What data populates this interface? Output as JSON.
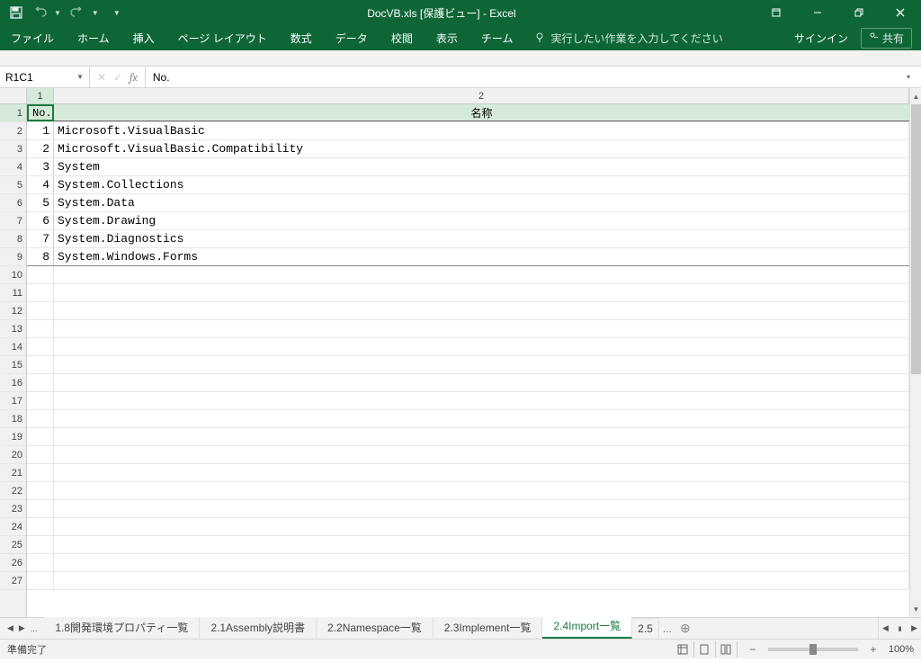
{
  "title": "DocVB.xls  [保護ビュー] - Excel",
  "qat": {
    "save": "save",
    "undo": "undo",
    "redo": "redo"
  },
  "win": {
    "ribbon_opts": "ribbon-options",
    "minimize": "minimize",
    "maximize": "restore",
    "close": "close"
  },
  "tabs": {
    "file": "ファイル",
    "home": "ホーム",
    "insert": "挿入",
    "page_layout": "ページ レイアウト",
    "formulas": "数式",
    "data": "データ",
    "review": "校閲",
    "view": "表示",
    "team": "チーム"
  },
  "tell_me": "実行したい作業を入力してください",
  "sign_in": "サインイン",
  "share": "共有",
  "name_box": "R1C1",
  "formula": "No.",
  "col_headers": {
    "c1": "1",
    "c2": "2"
  },
  "row_count": 27,
  "headers": {
    "no": "No.",
    "name": "名称"
  },
  "rows": [
    {
      "no": "1",
      "name": "Microsoft.VisualBasic"
    },
    {
      "no": "2",
      "name": "Microsoft.VisualBasic.Compatibility"
    },
    {
      "no": "3",
      "name": "System"
    },
    {
      "no": "4",
      "name": "System.Collections"
    },
    {
      "no": "5",
      "name": "System.Data"
    },
    {
      "no": "6",
      "name": "System.Drawing"
    },
    {
      "no": "7",
      "name": "System.Diagnostics"
    },
    {
      "no": "8",
      "name": "System.Windows.Forms"
    }
  ],
  "sheet_nav_ellipsis": "...",
  "sheets": [
    {
      "label": "1.8開発環境プロパティ一覧",
      "active": false
    },
    {
      "label": "2.1Assembly説明書",
      "active": false
    },
    {
      "label": "2.2Namespace一覧",
      "active": false
    },
    {
      "label": "2.3Implement一覧",
      "active": false
    },
    {
      "label": "2.4Import一覧",
      "active": true
    },
    {
      "label": "2.5",
      "active": false,
      "partial": true
    }
  ],
  "sheet_partial_ellipsis": "...",
  "status": {
    "ready": "準備完了",
    "zoom": "100%"
  }
}
